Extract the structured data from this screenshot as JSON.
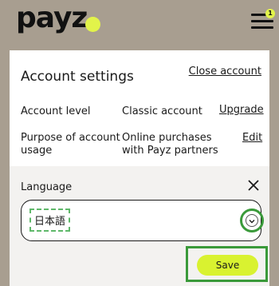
{
  "header": {
    "logo_text": "payz",
    "notification_count": "1",
    "brand_color": "#e2f34a",
    "menu_icon": "hamburger-menu-icon"
  },
  "account_settings": {
    "title": "Account settings",
    "close_account_link": "Close account",
    "rows": [
      {
        "label": "Account level",
        "value": "Classic account",
        "action": "Upgrade"
      },
      {
        "label_line1": "Purpose of account",
        "label_line2": "usage",
        "value_line1": "Online purchases",
        "value_line2": "with Payz partners",
        "action": "Edit"
      }
    ]
  },
  "language_panel": {
    "label": "Language",
    "selected_value": "日本語",
    "close_icon": "close-icon",
    "dropdown_icon": "chevron-down-icon",
    "save_label": "Save",
    "highlight_color": "#3a9a3a"
  }
}
